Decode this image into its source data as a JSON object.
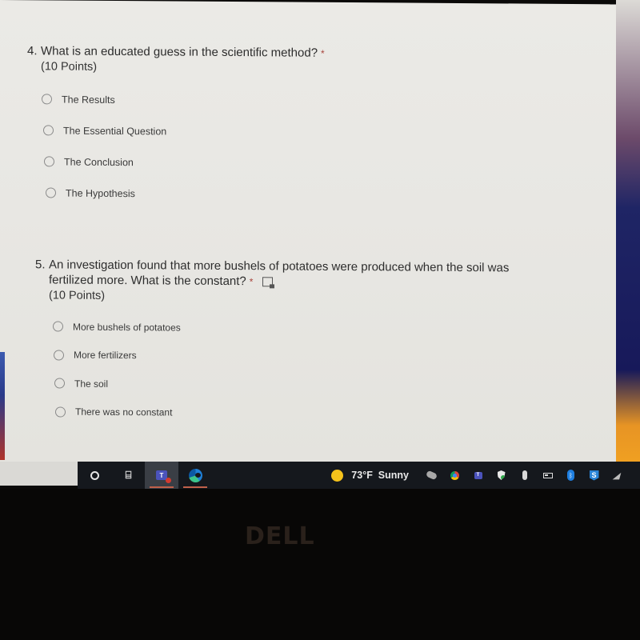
{
  "questions": [
    {
      "number": "4.",
      "text": "What is an educated guess in the scientific method?",
      "required_marker": "*",
      "points": "(10 Points)",
      "options": [
        "The Results",
        "The Essential Question",
        "The Conclusion",
        "The Hypothesis"
      ]
    },
    {
      "number": "5.",
      "text": "An investigation found that more bushels of potatoes were produced when the soil was fertilized more.  What is the constant?",
      "required_marker": "*",
      "has_immersive_reader_icon": true,
      "points": "(10 Points)",
      "options": [
        "More bushels of potatoes",
        "More fertilizers",
        "The soil",
        "There was no constant"
      ]
    }
  ],
  "taskbar": {
    "apps": [
      {
        "name": "cortana",
        "active": false
      },
      {
        "name": "task-view",
        "label": "⌸",
        "active": false
      },
      {
        "name": "microsoft-teams",
        "label": "T",
        "active": true
      },
      {
        "name": "microsoft-edge",
        "active": false
      }
    ],
    "weather": {
      "icon": "sun-icon",
      "temperature": "73°F",
      "condition": "Sunny"
    },
    "tray_icons": [
      "onedrive-offline-icon",
      "chrome-icon",
      "teams-icon",
      "security-shield-icon",
      "microphone-icon",
      "battery-icon",
      "bluetooth-icon",
      "s-app-icon",
      "wifi-icon"
    ],
    "bluetooth_glyph": "ᛒ",
    "s_glyph": "S",
    "wifi_glyph": "◢"
  },
  "bezel": {
    "brand": "DELL"
  },
  "colors": {
    "page_bg": "#e9e8e4",
    "text": "#2d2d2d",
    "required": "#a8443c",
    "taskbar": "#15181d",
    "teams": "#4b53bc",
    "sun": "#f5c21b"
  }
}
